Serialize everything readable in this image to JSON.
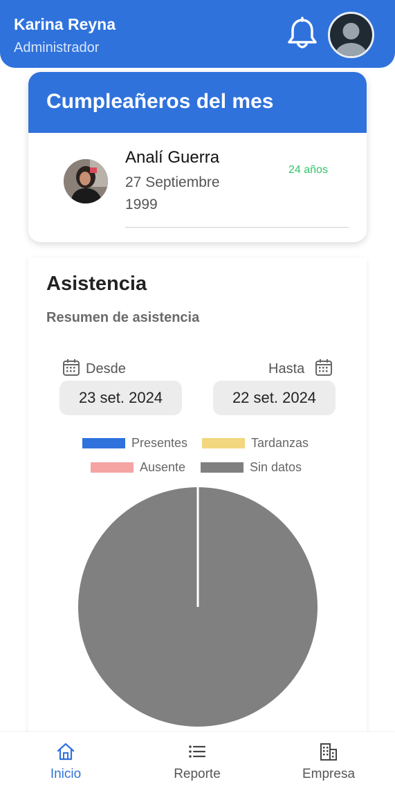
{
  "header": {
    "name": "Karina Reyna",
    "role": "Administrador"
  },
  "birthdays": {
    "title": "Cumpleañeros del mes",
    "person": {
      "name": "Analí Guerra",
      "date": "27 Septiembre 1999",
      "age": "24 años"
    }
  },
  "attendance": {
    "title": "Asistencia",
    "subtitle": "Resumen de asistencia",
    "from_label": "Desde",
    "to_label": "Hasta",
    "from_date": "23 set. 2024",
    "to_date": "22 set. 2024"
  },
  "chart_data": {
    "type": "pie",
    "legend": [
      {
        "label": "Presentes",
        "color": "#2f72dc"
      },
      {
        "label": "Tardanzas",
        "color": "#f2d77e"
      },
      {
        "label": "Ausente",
        "color": "#f5a3a3"
      },
      {
        "label": "Sin datos",
        "color": "#808080"
      }
    ],
    "values": [
      {
        "label": "Presentes",
        "value": 0
      },
      {
        "label": "Tardanzas",
        "value": 0
      },
      {
        "label": "Ausente",
        "value": 0
      },
      {
        "label": "Sin datos",
        "value": 100
      }
    ]
  },
  "nav": {
    "items": [
      {
        "label": "Inicio",
        "icon": "home-icon",
        "active": true
      },
      {
        "label": "Reporte",
        "icon": "list-icon",
        "active": false
      },
      {
        "label": "Empresa",
        "icon": "building-icon",
        "active": false
      }
    ]
  }
}
